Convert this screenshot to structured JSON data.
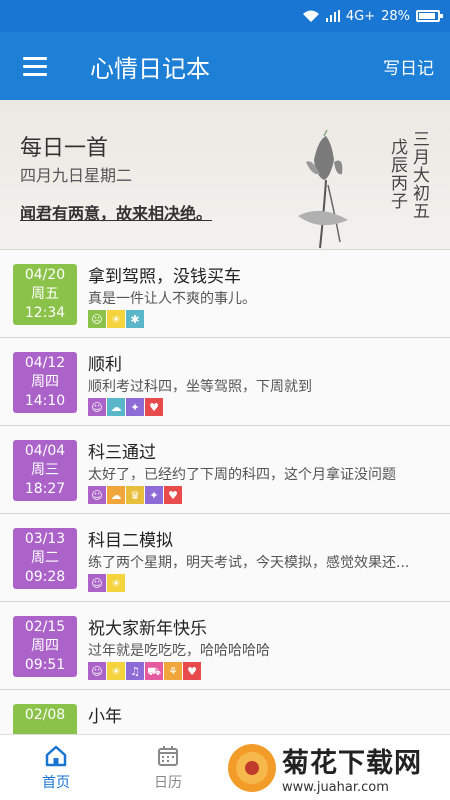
{
  "status": {
    "network": "4G+",
    "battery": "28%"
  },
  "appbar": {
    "title": "心情日记本",
    "action": "写日记"
  },
  "banner": {
    "title": "每日一首",
    "date": "四月九日星期二",
    "poem": "闻君有两意，故来相决绝。",
    "lunar_col1": "三月大初五",
    "lunar_col2": "戊辰丙子"
  },
  "entries": [
    {
      "date": "04/20",
      "weekday": "周五",
      "time": "12:34",
      "color": "#8bc34a",
      "title": "拿到驾照，没钱买车",
      "summary": "真是一件让人不爽的事儿。",
      "tags": [
        {
          "icon": "sad-face-icon",
          "glyph": "☹",
          "color": "#8bc34a"
        },
        {
          "icon": "sun-icon",
          "glyph": "☀",
          "color": "#f5d33d"
        },
        {
          "icon": "bug-icon",
          "glyph": "✱",
          "color": "#5ab7c9"
        }
      ]
    },
    {
      "date": "04/12",
      "weekday": "周四",
      "time": "14:10",
      "color": "#ab63c9",
      "title": "顺利",
      "summary": "顺利考过科四，坐等驾照，下周就到",
      "tags": [
        {
          "icon": "smile-face-icon",
          "glyph": "☺",
          "color": "#ab63c9"
        },
        {
          "icon": "rain-cloud-icon",
          "glyph": "☁",
          "color": "#5ab7c9"
        },
        {
          "icon": "person-cheer-icon",
          "glyph": "✦",
          "color": "#8e6cd8"
        },
        {
          "icon": "heart-icon",
          "glyph": "♥",
          "color": "#e84b4b"
        }
      ]
    },
    {
      "date": "04/04",
      "weekday": "周三",
      "time": "18:27",
      "color": "#ab63c9",
      "title": "科三通过",
      "summary": "太好了，已经约了下周的科四，这个月拿证没问题",
      "tags": [
        {
          "icon": "smile-face-icon",
          "glyph": "☺",
          "color": "#ab63c9"
        },
        {
          "icon": "sun-cloud-icon",
          "glyph": "☁",
          "color": "#f0a63a"
        },
        {
          "icon": "trophy-icon",
          "glyph": "♛",
          "color": "#e8bf3a"
        },
        {
          "icon": "person-cheer-icon",
          "glyph": "✦",
          "color": "#8e6cd8"
        },
        {
          "icon": "heart-icon",
          "glyph": "♥",
          "color": "#e84b4b"
        }
      ]
    },
    {
      "date": "03/13",
      "weekday": "周二",
      "time": "09:28",
      "color": "#ab63c9",
      "title": "科目二模拟",
      "summary": "练了两个星期，明天考试，今天模拟，感觉效果还...",
      "tags": [
        {
          "icon": "smile-face-icon",
          "glyph": "☺",
          "color": "#ab63c9"
        },
        {
          "icon": "sun-icon",
          "glyph": "☀",
          "color": "#f5d33d"
        }
      ]
    },
    {
      "date": "02/15",
      "weekday": "周四",
      "time": "09:51",
      "color": "#ab63c9",
      "title": "祝大家新年快乐",
      "summary": "过年就是吃吃吃，哈哈哈哈哈",
      "tags": [
        {
          "icon": "smile-face-icon",
          "glyph": "☺",
          "color": "#ab63c9"
        },
        {
          "icon": "sun-icon",
          "glyph": "☀",
          "color": "#f5d33d"
        },
        {
          "icon": "headphones-icon",
          "glyph": "♫",
          "color": "#8e6cd8"
        },
        {
          "icon": "shopping-cart-icon",
          "glyph": "⛟",
          "color": "#e65aa0"
        },
        {
          "icon": "food-icon",
          "glyph": "⚘",
          "color": "#f0a63a"
        },
        {
          "icon": "heart-icon",
          "glyph": "♥",
          "color": "#e84b4b"
        }
      ]
    },
    {
      "date": "02/08",
      "weekday": "",
      "time": "",
      "color": "#8bc34a",
      "title": "小年",
      "summary": "",
      "tags": []
    }
  ],
  "nav": {
    "home": "首页",
    "calendar": "日历"
  },
  "watermark": {
    "name": "菊花下载网",
    "url": "www.juahar.com"
  },
  "colors": {
    "primary": "#1e7fd7",
    "nav_active": "#1976d2"
  }
}
